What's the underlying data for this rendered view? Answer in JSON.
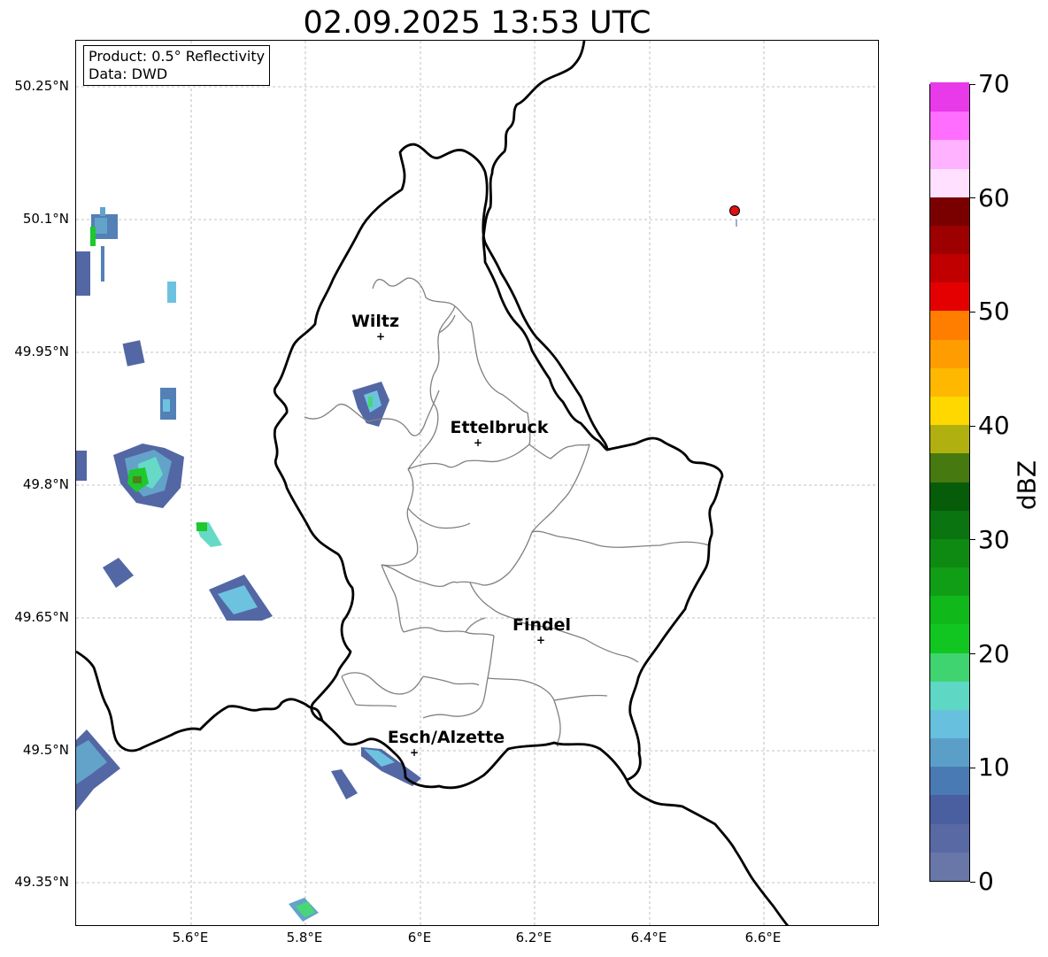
{
  "title": "02.09.2025 13:53 UTC",
  "info_box": {
    "product": "Product: 0.5° Reflectivity",
    "data_source": "Data: DWD"
  },
  "lat_labels": [
    "50.25°N",
    "50.1°N",
    "49.95°N",
    "49.8°N",
    "49.65°N",
    "49.5°N",
    "49.35°N"
  ],
  "lon_labels": [
    "5.6°E",
    "5.8°E",
    "6°E",
    "6.2°E",
    "6.4°E",
    "6.6°E"
  ],
  "cities": [
    {
      "name": "Wiltz"
    },
    {
      "name": "Ettelbruck"
    },
    {
      "name": "Findel"
    },
    {
      "name": "Esch/Alzette"
    }
  ],
  "colorbar": {
    "label": "dBZ",
    "tick_labels": [
      "0",
      "10",
      "20",
      "30",
      "40",
      "50",
      "60",
      "70"
    ],
    "colors": [
      "#6877a8",
      "#5869a3",
      "#4a5fa0",
      "#4a7ab3",
      "#5b9fc8",
      "#66c0de",
      "#5ed8c4",
      "#40d470",
      "#12c622",
      "#10b81a",
      "#109e16",
      "#0e8a12",
      "#0a7410",
      "#075c0a",
      "#467a10",
      "#b0b010",
      "#ffd800",
      "#ffb800",
      "#ff9c00",
      "#ff7e00",
      "#e40000",
      "#c00000",
      "#9c0000",
      "#7a0000",
      "#ffe0ff",
      "#ffb2ff",
      "#ff6eff",
      "#e83ae8"
    ]
  },
  "colors": {
    "country_border": "#000000",
    "district_border": "#808080",
    "grid": "#b0b0b0",
    "marker": "#e01010"
  }
}
